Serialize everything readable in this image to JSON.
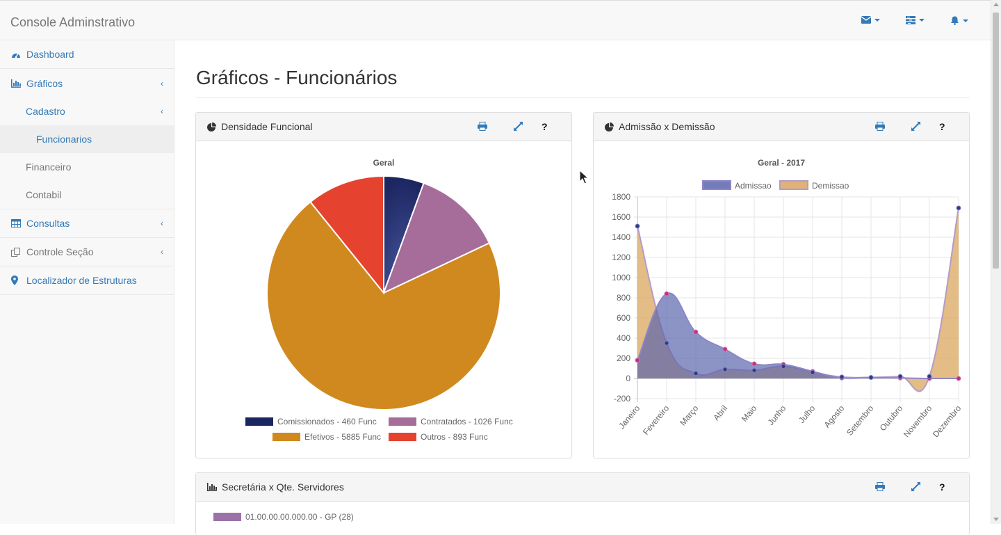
{
  "app": {
    "title": "Console Adminstrativo"
  },
  "topbar": {
    "icons": [
      "envelope-icon",
      "tasks-icon",
      "bell-icon"
    ]
  },
  "sidebar": {
    "dashboard": "Dashboard",
    "graficos": "Gráficos",
    "cadastro": "Cadastro",
    "funcionarios": "Funcionarios",
    "financeiro": "Financeiro",
    "contabil": "Contabil",
    "consultas": "Consultas",
    "controle": "Controle Seção",
    "localizador": "Localizador de Estruturas"
  },
  "page": {
    "title": "Gráficos - Funcionários"
  },
  "panels": {
    "densidade": {
      "title": "Densidade Funcional",
      "help": "?"
    },
    "admissao": {
      "title": "Admissão x Demissão",
      "help": "?"
    },
    "secretaria": {
      "title": "Secretária x Qte. Servidores",
      "help": "?",
      "legend_first": "01.00.00.00.000.00 - GP (28)"
    }
  },
  "colors": {
    "link": "#337ab7",
    "comissionados": "#1b2560",
    "contratados": "#a76d9a",
    "efetivos": "#d0891f",
    "outros": "#e5432f",
    "admissao": "#5b65ad",
    "demissao": "#d9a55d"
  },
  "chart_data": [
    {
      "type": "pie",
      "title": "Geral",
      "slices": [
        {
          "label": "Comissionados - 460 Func",
          "value": 460,
          "color": "#1b2560"
        },
        {
          "label": "Contratados - 1026 Func",
          "value": 1026,
          "color": "#a76d9a"
        },
        {
          "label": "Efetivos - 5885 Func",
          "value": 5885,
          "color": "#d0891f"
        },
        {
          "label": "Outros - 893 Func",
          "value": 893,
          "color": "#e5432f"
        }
      ]
    },
    {
      "type": "area",
      "title": "Geral - 2017",
      "categories": [
        "Janeiro",
        "Fevereiro",
        "Março",
        "Abril",
        "Maio",
        "Junho",
        "Julho",
        "Agosto",
        "Setembro",
        "Outubro",
        "Novembro",
        "Dezembro"
      ],
      "series": [
        {
          "name": "Admissao",
          "values": [
            180,
            840,
            460,
            290,
            145,
            140,
            70,
            5,
            10,
            5,
            0,
            0
          ],
          "color": "#5b65ad"
        },
        {
          "name": "Demissao",
          "values": [
            1510,
            350,
            50,
            90,
            80,
            120,
            60,
            15,
            10,
            20,
            20,
            1690
          ],
          "color": "#d9a55d"
        }
      ],
      "ylim": [
        -200,
        1800
      ],
      "yticks": [
        -200,
        0,
        200,
        400,
        600,
        800,
        1000,
        1200,
        1400,
        1600,
        1800
      ],
      "grid": true,
      "legend": "top"
    }
  ],
  "legend3": {
    "first_color": "#9b72a8"
  }
}
